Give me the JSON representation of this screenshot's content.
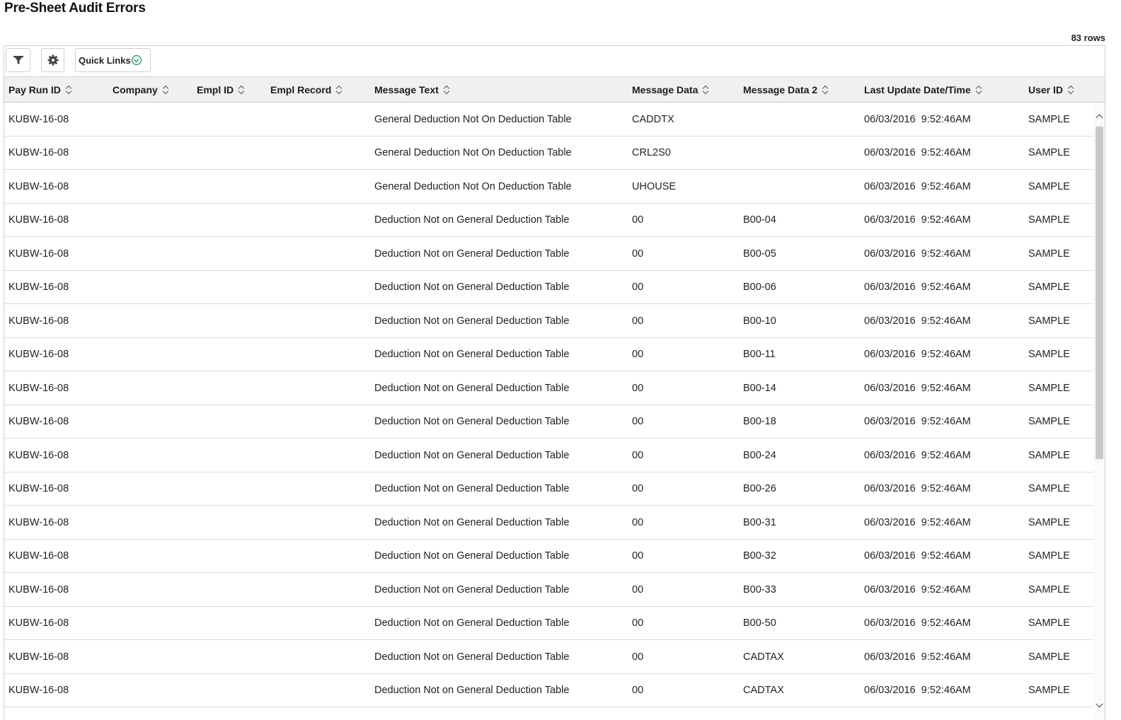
{
  "page": {
    "title": "Pre-Sheet Audit Errors",
    "row_count": "83 rows"
  },
  "toolbar": {
    "filter_icon": "filter-icon",
    "settings_icon": "gear-icon",
    "quick_links_label": "Quick Links",
    "quick_links_icon": "chevron-down-circle-icon"
  },
  "columns": [
    "Pay Run ID",
    "Company",
    "Empl ID",
    "Empl Record",
    "Message Text",
    "Message Data",
    "Message Data 2",
    "Last Update Date/Time",
    "User ID"
  ],
  "rows": [
    [
      "KUBW-16-08",
      "",
      "",
      "",
      "General Deduction Not On Deduction Table",
      "CADDTX",
      "",
      "06/03/2016  9:52:46AM",
      "SAMPLE"
    ],
    [
      "KUBW-16-08",
      "",
      "",
      "",
      "General Deduction Not On Deduction Table",
      "CRL2S0",
      "",
      "06/03/2016  9:52:46AM",
      "SAMPLE"
    ],
    [
      "KUBW-16-08",
      "",
      "",
      "",
      "General Deduction Not On Deduction Table",
      "UHOUSE",
      "",
      "06/03/2016  9:52:46AM",
      "SAMPLE"
    ],
    [
      "KUBW-16-08",
      "",
      "",
      "",
      "Deduction Not on General Deduction Table",
      "00",
      "B00-04",
      "06/03/2016  9:52:46AM",
      "SAMPLE"
    ],
    [
      "KUBW-16-08",
      "",
      "",
      "",
      "Deduction Not on General Deduction Table",
      "00",
      "B00-05",
      "06/03/2016  9:52:46AM",
      "SAMPLE"
    ],
    [
      "KUBW-16-08",
      "",
      "",
      "",
      "Deduction Not on General Deduction Table",
      "00",
      "B00-06",
      "06/03/2016  9:52:46AM",
      "SAMPLE"
    ],
    [
      "KUBW-16-08",
      "",
      "",
      "",
      "Deduction Not on General Deduction Table",
      "00",
      "B00-10",
      "06/03/2016  9:52:46AM",
      "SAMPLE"
    ],
    [
      "KUBW-16-08",
      "",
      "",
      "",
      "Deduction Not on General Deduction Table",
      "00",
      "B00-11",
      "06/03/2016  9:52:46AM",
      "SAMPLE"
    ],
    [
      "KUBW-16-08",
      "",
      "",
      "",
      "Deduction Not on General Deduction Table",
      "00",
      "B00-14",
      "06/03/2016  9:52:46AM",
      "SAMPLE"
    ],
    [
      "KUBW-16-08",
      "",
      "",
      "",
      "Deduction Not on General Deduction Table",
      "00",
      "B00-18",
      "06/03/2016  9:52:46AM",
      "SAMPLE"
    ],
    [
      "KUBW-16-08",
      "",
      "",
      "",
      "Deduction Not on General Deduction Table",
      "00",
      "B00-24",
      "06/03/2016  9:52:46AM",
      "SAMPLE"
    ],
    [
      "KUBW-16-08",
      "",
      "",
      "",
      "Deduction Not on General Deduction Table",
      "00",
      "B00-26",
      "06/03/2016  9:52:46AM",
      "SAMPLE"
    ],
    [
      "KUBW-16-08",
      "",
      "",
      "",
      "Deduction Not on General Deduction Table",
      "00",
      "B00-31",
      "06/03/2016  9:52:46AM",
      "SAMPLE"
    ],
    [
      "KUBW-16-08",
      "",
      "",
      "",
      "Deduction Not on General Deduction Table",
      "00",
      "B00-32",
      "06/03/2016  9:52:46AM",
      "SAMPLE"
    ],
    [
      "KUBW-16-08",
      "",
      "",
      "",
      "Deduction Not on General Deduction Table",
      "00",
      "B00-33",
      "06/03/2016  9:52:46AM",
      "SAMPLE"
    ],
    [
      "KUBW-16-08",
      "",
      "",
      "",
      "Deduction Not on General Deduction Table",
      "00",
      "B00-50",
      "06/03/2016  9:52:46AM",
      "SAMPLE"
    ],
    [
      "KUBW-16-08",
      "",
      "",
      "",
      "Deduction Not on General Deduction Table",
      "00",
      "CADTAX",
      "06/03/2016  9:52:46AM",
      "SAMPLE"
    ],
    [
      "KUBW-16-08",
      "",
      "",
      "",
      "Deduction Not on General Deduction Table",
      "00",
      "CADTAX",
      "06/03/2016  9:52:46AM",
      "SAMPLE"
    ]
  ],
  "colors": {
    "header_bg": "#f0f0f0",
    "accent": "#1a7f5a"
  }
}
